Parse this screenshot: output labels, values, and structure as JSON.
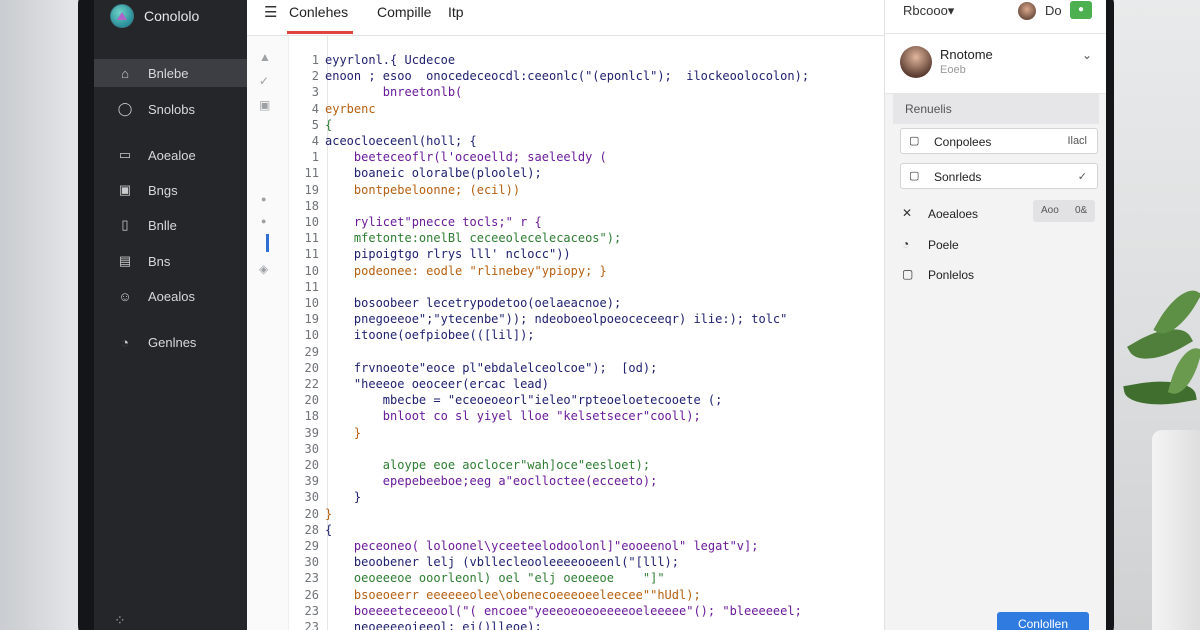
{
  "app": {
    "name": "Conololo"
  },
  "sidebar": {
    "items": [
      {
        "label": "Bnlebe",
        "icon": "home-icon",
        "glyph": "⌂",
        "active": true
      },
      {
        "label": "Snolobs",
        "icon": "circle-icon",
        "glyph": "◯",
        "active": false
      },
      {
        "label": "Aoealoe",
        "icon": "folder-icon",
        "glyph": "▭",
        "active": false
      },
      {
        "label": "Bngs",
        "icon": "image-icon",
        "glyph": "▣",
        "active": false
      },
      {
        "label": "Bnlle",
        "icon": "file-icon",
        "glyph": "▯",
        "active": false
      },
      {
        "label": "Bns",
        "icon": "library-icon",
        "glyph": "▤",
        "active": false
      },
      {
        "label": "Aoealos",
        "icon": "face-icon",
        "glyph": "☺",
        "active": false
      },
      {
        "label": "Genlnes",
        "icon": "settings-icon",
        "glyph": "◔",
        "active": false
      }
    ]
  },
  "topbar": {
    "menu_glyph": "☰",
    "tabs": [
      {
        "label": "Conlehes"
      },
      {
        "label": "Compille"
      },
      {
        "label": "Itp"
      }
    ]
  },
  "gutter": {
    "icons": [
      {
        "name": "triangle-icon",
        "glyph": "▲"
      },
      {
        "name": "check-icon",
        "glyph": "✓"
      },
      {
        "name": "page-icon",
        "glyph": "▣"
      },
      {
        "name": "dot-icon",
        "glyph": "●"
      },
      {
        "name": "dot-icon-2",
        "glyph": "●"
      },
      {
        "name": "tag-icon",
        "glyph": "◈"
      }
    ]
  },
  "code": {
    "lines": [
      {
        "n": "1",
        "t": "eyyrlonl.{ Ucdecoe"
      },
      {
        "n": "2",
        "t": "enoon ; esoo  onocedeceocdl:ceeonlc(\"(eponlcl\");  ilockeoolocolon);"
      },
      {
        "n": "3",
        "t": "        bnreetonlb("
      },
      {
        "n": "4",
        "t": "eyrbenc"
      },
      {
        "n": "5",
        "t": "{"
      },
      {
        "n": "4",
        "t": "aceocloeceenl(holl; {"
      },
      {
        "n": "1",
        "t": "    beeteceoflr(l'oceoelld; saeleeldy ("
      },
      {
        "n": "11",
        "t": "    boaneic oloralbe(ploolel);"
      },
      {
        "n": "19",
        "t": "    bontpebeloonne; (ecil))"
      },
      {
        "n": "18",
        "t": ""
      },
      {
        "n": "10",
        "t": "    rylicet\"pnecce tocls;\" r {"
      },
      {
        "n": "11",
        "t": "    mfetonte:onelBl ceceeolecelecaceos\");"
      },
      {
        "n": "11",
        "t": "    pipoigtgo rlrys lll' nclocc\"))"
      },
      {
        "n": "10",
        "t": "    podeonee: eodle \"rlinebey\"ypiopy; }"
      },
      {
        "n": "11",
        "t": ""
      },
      {
        "n": "10",
        "t": "    bosoobeer lecetrypodetoo(oelaeacnoe);"
      },
      {
        "n": "19",
        "t": "    pnegoeeoe\";\"ytecenbe\")); ndeoboeolpoeoceceeqr) ilie:); tolc\""
      },
      {
        "n": "10",
        "t": "    itoone(oefpiobee(([lil]);"
      },
      {
        "n": "29",
        "t": ""
      },
      {
        "n": "20",
        "t": "    frvnoeote\"eoce pl\"ebdalelceolcoe\");  [od);"
      },
      {
        "n": "22",
        "t": "    \"heeeoe oeoceer(ercac lead)"
      },
      {
        "n": "20",
        "t": "        mbecbe = \"eceoeoeorl\"ieleo\"rpteoeloetecooete (;"
      },
      {
        "n": "18",
        "t": "        bnloot co sl yiyel lloe \"kelsetsecer\"cooll);"
      },
      {
        "n": "39",
        "t": "    }"
      },
      {
        "n": "30",
        "t": ""
      },
      {
        "n": "20",
        "t": "        aloype eoe aoclocer\"wah]oce\"eesloet);"
      },
      {
        "n": "39",
        "t": "        epepebeeboe;eeg a\"eoclloctee(ecceeto);"
      },
      {
        "n": "30",
        "t": "    }"
      },
      {
        "n": "20",
        "t": "}"
      },
      {
        "n": "28",
        "t": "{"
      },
      {
        "n": "29",
        "t": "    peceoneo( loloonel\\yceeteelodoolonl]\"eooeenol\" legat\"v];"
      },
      {
        "n": "30",
        "t": "    beoobener lelj (vbllecleooleeeeooeenl(\"[lll);"
      },
      {
        "n": "23",
        "t": "    oeoeeeoe ooorleonl) oel \"elj oeoeeoe    \"]\""
      },
      {
        "n": "26",
        "t": "    bsoeoeerr eeeeeeolee\\obenecoeeeoeeleecee\"\"hUdl);"
      },
      {
        "n": "23",
        "t": "    boeeeeteceeool(\"( encoee\"yeeeoeoeoeeeeoeleeeee\"(); \"bleeeeeel;"
      },
      {
        "n": "23",
        "t": "    neoeeeeoieeol; ei()lleoe);"
      }
    ]
  },
  "right": {
    "dropdown": "Rbcooo▾",
    "top_label": "Do",
    "user": {
      "name": "Rnotome",
      "sub": "Eoeb"
    },
    "section": "Renuelis",
    "cards": [
      {
        "label": "Conpolees",
        "right": "Ilacl",
        "icon": "square-icon",
        "glyph": "▢"
      },
      {
        "label": "Sonrleds",
        "right": "✓",
        "icon": "square-icon-2",
        "glyph": "▢"
      }
    ],
    "rows": [
      {
        "label": "Aoealoes",
        "icon": "x-icon",
        "glyph": "✕"
      },
      {
        "label": "Poele",
        "icon": "clock-icon",
        "glyph": "◔"
      },
      {
        "label": "Ponlelos",
        "icon": "square-icon-3",
        "glyph": "▢"
      }
    ],
    "pill": [
      "Aoo",
      "0&"
    ],
    "button": "Conlollen"
  },
  "colors": {
    "accent_red": "#e0473c",
    "accent_blue": "#2f7be0",
    "badge_green": "#4caf50",
    "code_purple": "#6a1b9a",
    "code_orange": "#b65f10",
    "code_green": "#2e7d32",
    "code_navy": "#1d1f6e"
  }
}
